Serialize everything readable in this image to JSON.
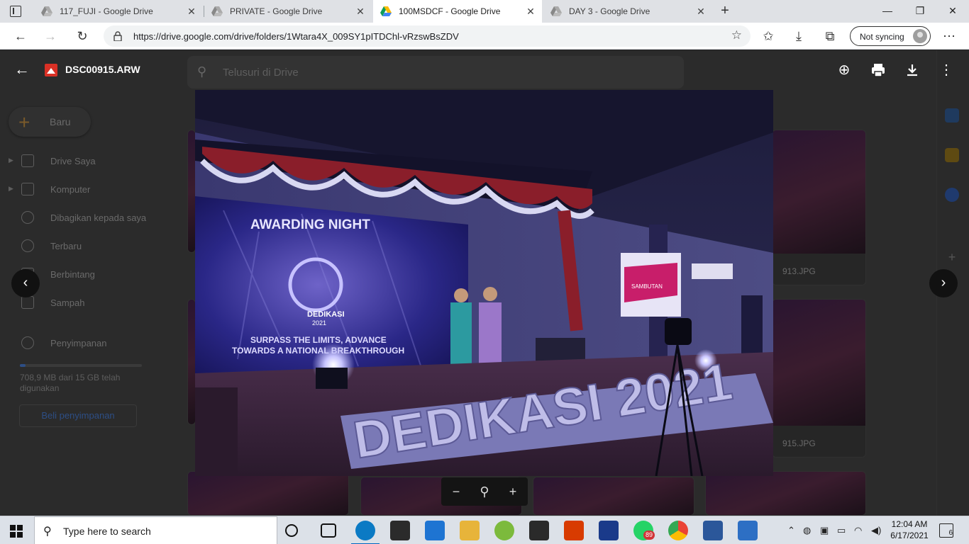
{
  "browser": {
    "tabs": [
      {
        "title": "117_FUJI - Google Drive",
        "active": false
      },
      {
        "title": "PRIVATE - Google Drive",
        "active": false
      },
      {
        "title": "100MSDCF - Google Drive",
        "active": true
      },
      {
        "title": "DAY 3 - Google Drive",
        "active": false
      }
    ],
    "url": "https://drive.google.com/drive/folders/1Wtara4X_009SY1pITDChl-vRzswBsZDV",
    "sync_label": "Not syncing"
  },
  "drive": {
    "search_placeholder": "Telusuri di Drive",
    "new_label": "Baru",
    "nav": [
      {
        "label": "Drive Saya",
        "icon": "drive-icon"
      },
      {
        "label": "Komputer",
        "icon": "computer-icon"
      },
      {
        "label": "Dibagikan kepada saya",
        "icon": "people-icon"
      },
      {
        "label": "Terbaru",
        "icon": "clock-icon"
      },
      {
        "label": "Berbintang",
        "icon": "star-icon"
      },
      {
        "label": "Sampah",
        "icon": "trash-icon"
      }
    ],
    "storage_label": "Penyimpanan",
    "storage_text": "708,9 MB dari 15 GB telah digunakan",
    "storage_fraction": 0.047,
    "buy_label": "Beli penyimpanan",
    "thumb_captions": [
      "913.JPG",
      "915.JPG"
    ]
  },
  "viewer": {
    "file_name": "DSC00915.ARW",
    "photo": {
      "banner_title": "AWARDING NIGHT",
      "banner_logo_text": "DEDIKASI",
      "banner_year": "2021",
      "banner_tagline_1": "SURPASS THE LIMITS, ADVANCE",
      "banner_tagline_2": "TOWARDS A NATIONAL BREAKTHROUGH",
      "stage_letters": "DEDIKASI 2021",
      "screen_text": "SAMBUTAN"
    }
  },
  "taskbar": {
    "search_placeholder": "Type here to search",
    "time": "12:04 AM",
    "date": "6/17/2021",
    "whatsapp_badge": "89",
    "notif_count": "6"
  },
  "colors": {
    "accent": "#0067c0",
    "viewer_bg": "#1f1f1f",
    "drive_red": "#d93025"
  }
}
